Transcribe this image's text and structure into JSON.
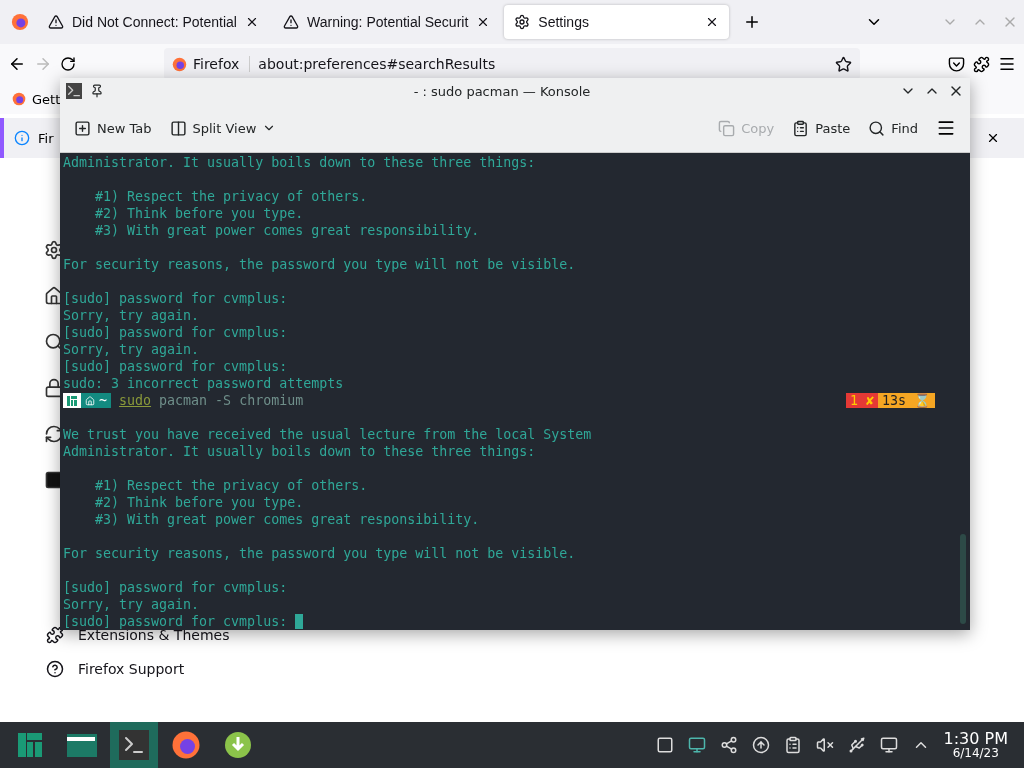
{
  "browser": {
    "tabs": [
      {
        "label": "Did Not Connect: Potential",
        "kind": "warning",
        "selected": false
      },
      {
        "label": "Warning: Potential Securit",
        "kind": "warning",
        "selected": false
      },
      {
        "label": "Settings",
        "kind": "settings",
        "selected": true
      }
    ],
    "url_label": "Firefox",
    "url": "about:preferences#searchResults",
    "bookmark": "Gett",
    "notification": "Fir",
    "sidebar": [
      {
        "label": "Extensions & Themes",
        "kind": "puzzle"
      },
      {
        "label": "Firefox Support",
        "kind": "help"
      }
    ]
  },
  "konsole": {
    "title": "- : sudo pacman — Konsole",
    "toolbar": [
      {
        "label": "New Tab",
        "kind": "new-tab",
        "disabled": false
      },
      {
        "label": "Split View",
        "kind": "split",
        "disabled": false
      },
      {
        "label": "Copy",
        "kind": "copy",
        "disabled": true
      },
      {
        "label": "Paste",
        "kind": "paste",
        "disabled": false
      },
      {
        "label": "Find",
        "kind": "find",
        "disabled": false
      }
    ],
    "lines": [
      {
        "kind": "text",
        "text": "Administrator. It usually boils down to these three things:"
      },
      {
        "kind": "blank"
      },
      {
        "kind": "text",
        "text": "    #1) Respect the privacy of others."
      },
      {
        "kind": "text",
        "text": "    #2) Think before you type."
      },
      {
        "kind": "text",
        "text": "    #3) With great power comes great responsibility."
      },
      {
        "kind": "blank"
      },
      {
        "kind": "text",
        "text": "For security reasons, the password you type will not be visible."
      },
      {
        "kind": "blank"
      },
      {
        "kind": "text",
        "text": "[sudo] password for cvmplus:"
      },
      {
        "kind": "text",
        "text": "Sorry, try again."
      },
      {
        "kind": "text",
        "text": "[sudo] password for cvmplus:"
      },
      {
        "kind": "text",
        "text": "Sorry, try again."
      },
      {
        "kind": "text",
        "text": "[sudo] password for cvmplus:"
      },
      {
        "kind": "text",
        "text": "sudo: 3 incorrect password attempts"
      },
      {
        "kind": "prompt",
        "dir": "~",
        "command": "sudo",
        "args": "pacman -S chromium",
        "status": "1 ✘",
        "duration": "13s ⌛"
      },
      {
        "kind": "blank"
      },
      {
        "kind": "text",
        "text": "We trust you have received the usual lecture from the local System"
      },
      {
        "kind": "text",
        "text": "Administrator. It usually boils down to these three things:"
      },
      {
        "kind": "blank"
      },
      {
        "kind": "text",
        "text": "    #1) Respect the privacy of others."
      },
      {
        "kind": "text",
        "text": "    #2) Think before you type."
      },
      {
        "kind": "text",
        "text": "    #3) With great power comes great responsibility."
      },
      {
        "kind": "blank"
      },
      {
        "kind": "text",
        "text": "For security reasons, the password you type will not be visible."
      },
      {
        "kind": "blank"
      },
      {
        "kind": "text",
        "text": "[sudo] password for cvmplus:"
      },
      {
        "kind": "text",
        "text": "Sorry, try again."
      },
      {
        "kind": "input",
        "text": "[sudo] password for cvmplus: "
      }
    ]
  },
  "taskbar": {
    "apps": [
      {
        "kind": "menu",
        "selected": false
      },
      {
        "kind": "files",
        "selected": false
      },
      {
        "kind": "terminal",
        "selected": true
      },
      {
        "kind": "firefox",
        "selected": false
      },
      {
        "kind": "download",
        "selected": false
      }
    ],
    "time": "1:30 PM",
    "date": "6/14/23"
  }
}
